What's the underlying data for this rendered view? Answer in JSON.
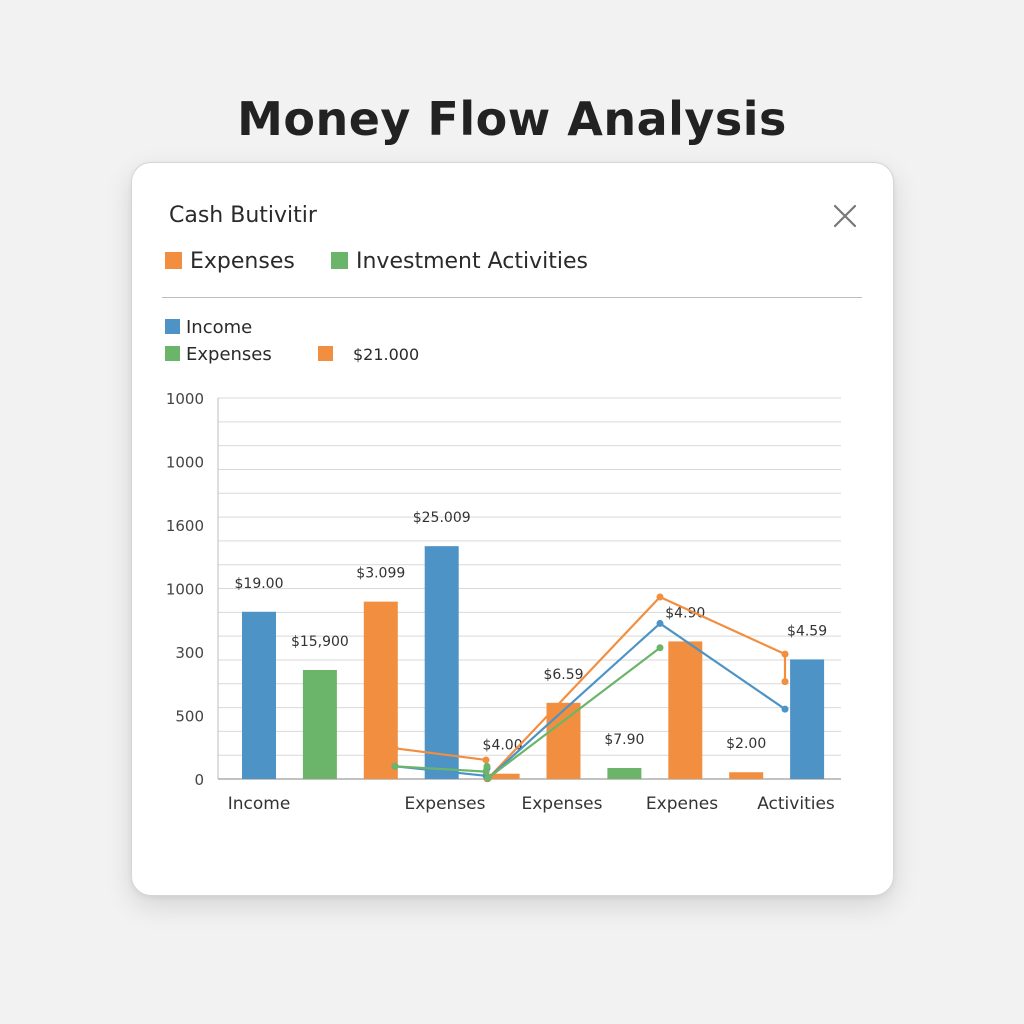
{
  "page": {
    "title": "Money Flow Analysis"
  },
  "panel": {
    "title": "Cash Butivitir",
    "close_icon": "close-icon",
    "legend_top": [
      {
        "label": "Expenses",
        "color": "#f28e3f"
      },
      {
        "label": "Investment Activities",
        "color": "#6bb56b"
      }
    ],
    "legend_inner": [
      {
        "label": "Income",
        "color": "#4e93c6"
      },
      {
        "label": "Expenses",
        "color": "#6bb56b"
      },
      {
        "label": "$21.000",
        "color": "#f28e3f"
      }
    ]
  },
  "chart_data": {
    "type": "bar",
    "y_tick_labels": [
      "0",
      "500",
      "300",
      "1000",
      "1600",
      "1000",
      "1000"
    ],
    "ylim": [
      0,
      1800
    ],
    "x_tick_labels": [
      "Income",
      "Expenses",
      "Expenses",
      "Expenes",
      "Activities"
    ],
    "grid": true,
    "bars": [
      {
        "color": "#4e93c6",
        "value": 790,
        "label": "$19.00"
      },
      {
        "color": "#6bb56b",
        "value": 515,
        "label": "$15,900"
      },
      {
        "color": "#f28e3f",
        "value": 838,
        "label": "$3.099"
      },
      {
        "color": "#4e93c6",
        "value": 1100,
        "label": "$25.009"
      },
      {
        "color": "#f28e3f",
        "value": 25,
        "label": "$4.00"
      },
      {
        "color": "#f28e3f",
        "value": 360,
        "label": "$6.59"
      },
      {
        "color": "#6bb56b",
        "value": 52,
        "label": "$7.90"
      },
      {
        "color": "#f28e3f",
        "value": 650,
        "label": "$4.90"
      },
      {
        "color": "#f28e3f",
        "value": 32,
        "label": "$2.00"
      },
      {
        "color": "#4e93c6",
        "value": 565,
        "label": "$4.59"
      }
    ],
    "series": [
      {
        "color": "#f28e3f",
        "values": [
          [
            0,
            145
          ],
          [
            1,
            90
          ],
          [
            2,
            1
          ],
          [
            3,
            2
          ],
          [
            4,
            860
          ],
          [
            5,
            590
          ],
          [
            6,
            460
          ]
        ]
      },
      {
        "color": "#4e93c6",
        "values": [
          [
            0,
            60
          ],
          [
            1,
            15
          ],
          [
            2,
            50
          ],
          [
            3,
            3
          ],
          [
            4,
            735
          ],
          [
            5,
            330
          ]
        ]
      },
      {
        "color": "#6bb56b",
        "values": [
          [
            0,
            60
          ],
          [
            1,
            35
          ],
          [
            2,
            60
          ],
          [
            3,
            4
          ],
          [
            4,
            620
          ]
        ]
      }
    ]
  }
}
